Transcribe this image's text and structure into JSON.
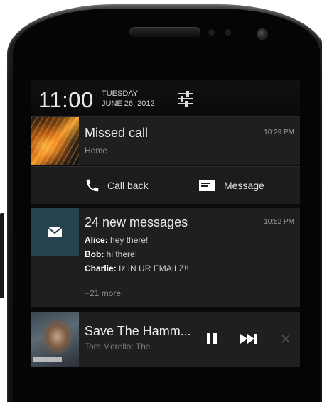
{
  "status": {
    "time": "11:00",
    "day": "TUESDAY",
    "date": "JUNE 26, 2012",
    "settings_icon": "settings-sliders-icon"
  },
  "notifications": {
    "missed_call": {
      "title": "Missed call",
      "subtitle": "Home",
      "time": "10:29 PM",
      "actions": [
        {
          "label": "Call back",
          "icon": "phone-icon"
        },
        {
          "label": "Message",
          "icon": "message-icon"
        }
      ]
    },
    "email": {
      "title": "24 new messages",
      "time": "10:52 PM",
      "icon": "mail-icon",
      "accent": "#24434f",
      "lines": [
        {
          "sender": "Alice",
          "text": " hey there!"
        },
        {
          "sender": "Bob",
          "text": " hi there!"
        },
        {
          "sender": "Charlie",
          "text": " Iz IN UR EMAILZ!!"
        }
      ],
      "more": "+21 more"
    },
    "music": {
      "title": "Save The Hamm...",
      "artist": "Tom Morello: The...",
      "controls": [
        "pause-icon",
        "skip-next-icon",
        "close-icon"
      ]
    }
  }
}
